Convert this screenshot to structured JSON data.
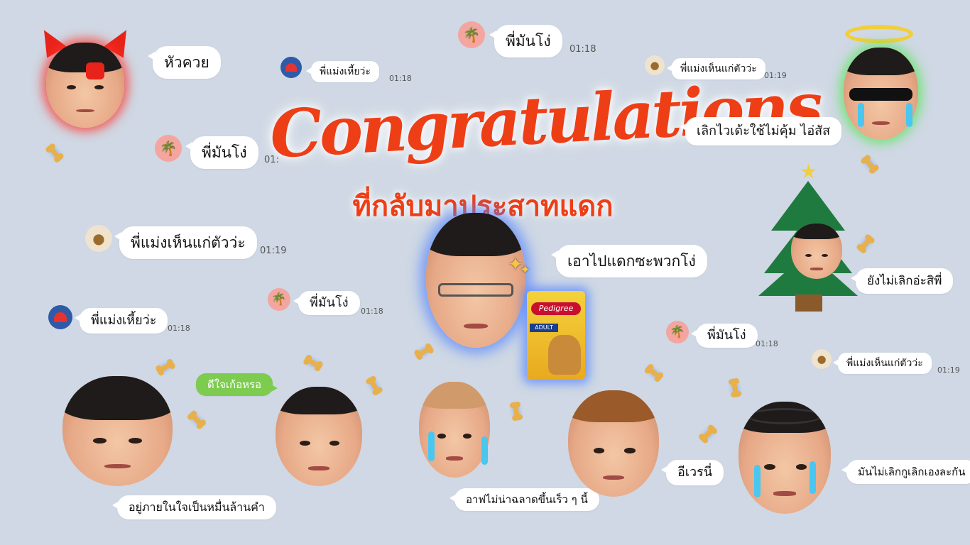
{
  "title": "Congratulations",
  "subtitle": "ที่กลับมาประสาทแดก",
  "messages": {
    "m1": "หัวควย",
    "m2": "พี่แม่งเหี้ยว่ะ",
    "m2_time": "01:18",
    "m3": "พี่มันโง่",
    "m3_time": "01:18",
    "m4": "พี่แม่งเห็นแก่ตัวว่ะ",
    "m4_time": "01:19",
    "m5": "พี่มันโง่",
    "m5_time": "01:",
    "m6": "เลิกไวเด้ะใช้ไม่คุ้ม ไอ่สัส",
    "m7": "พี่แม่งเห็นแก่ตัวว่ะ",
    "m7_time": "01:19",
    "m8": "เอาไปแดกซะพวกโง่",
    "m9": "ยังไม่เลิกอ่ะสิพี่",
    "m10": "พี่มันโง่",
    "m10_time": "01:18",
    "m11": "พี่แม่งเหี้ยว่ะ",
    "m11_time": "01:18",
    "m12": "พี่มันโง่",
    "m12_time": "01:18",
    "m13": "พี่แม่งเห็นแก่ตัวว่ะ",
    "m13_time": "01:19",
    "m14": "ดีใจเก้อหรอ",
    "m15": "อีเวรนี่",
    "m16": "มันไม่เลิกกูเลิกเองละกัน",
    "m17": "อยู่ภายในใจเป็นหมื่นล้านคำ",
    "m18": "อาฟไม่น่าฉลาดขึ้นเร็ว ๆ นี้"
  },
  "product": {
    "brand": "Pedigree",
    "label": "ADULT"
  },
  "colors": {
    "background": "#cfd8e4",
    "accent": "#ee3e16",
    "green_bubble": "#7dcb4f"
  },
  "icons": [
    "palm-tree-icon",
    "acorn-icon",
    "pokeball-icon",
    "devil-horns-icon",
    "halo-icon",
    "christmas-tree-icon",
    "bone-icon",
    "sparkle-icon"
  ]
}
